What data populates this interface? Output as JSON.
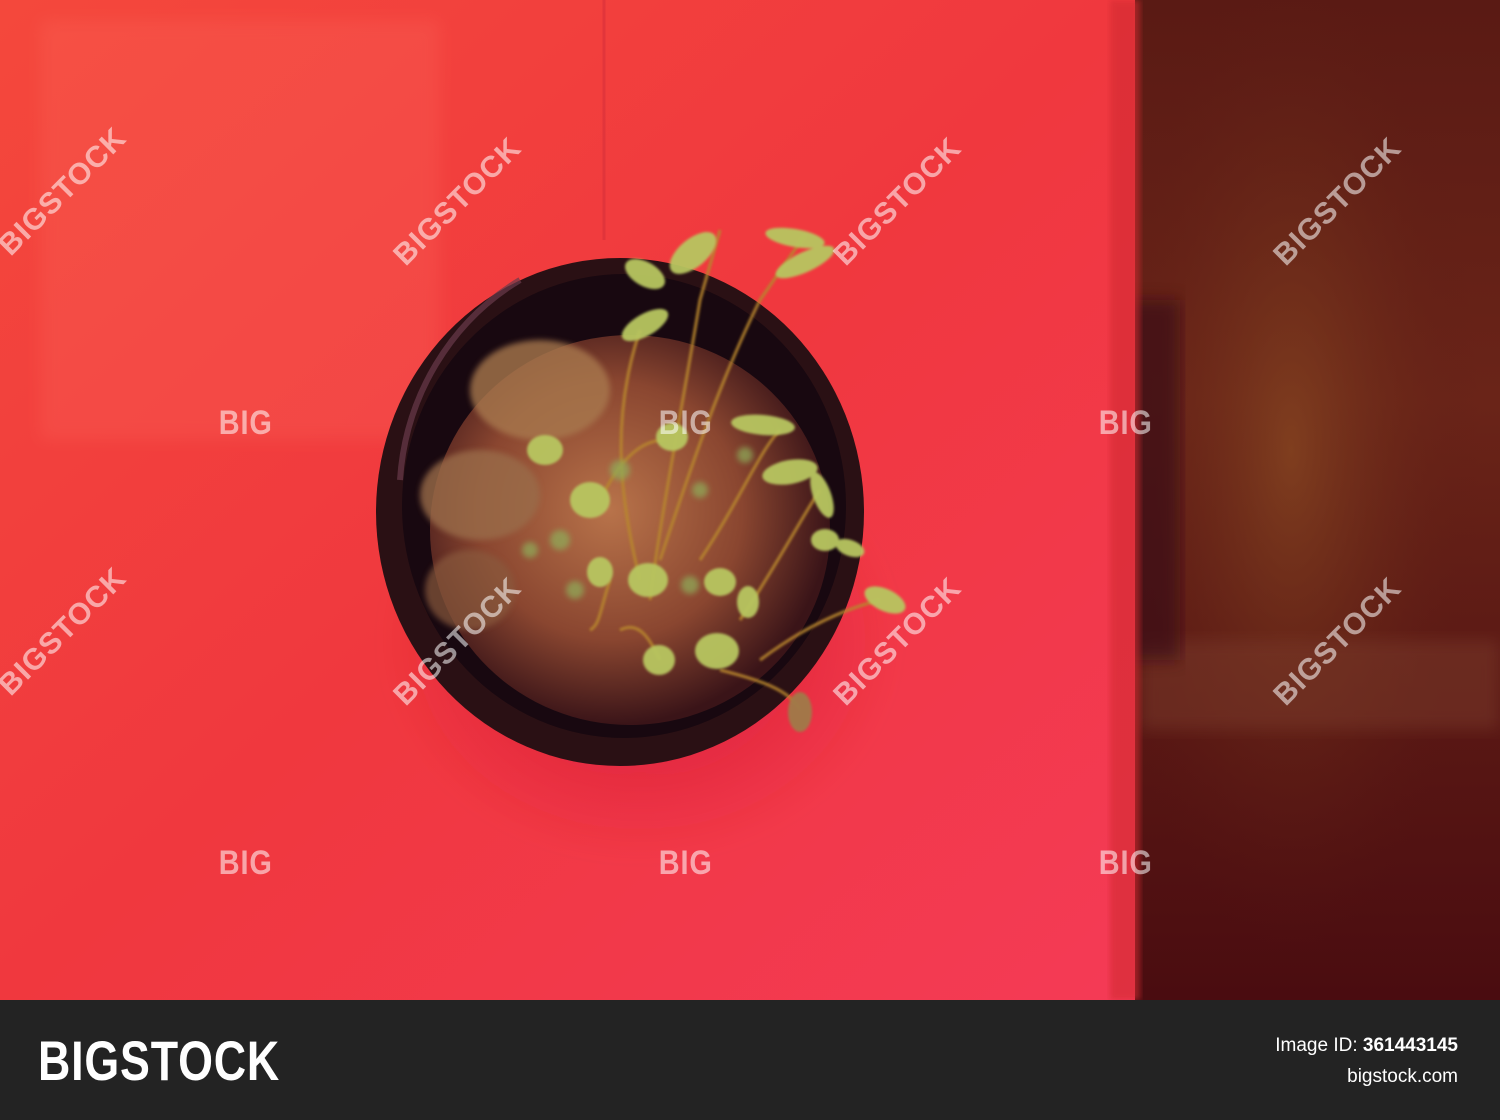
{
  "photo": {
    "subject": "seedling-in-black-pot",
    "colors": {
      "wall": "#f03a3a",
      "pot": "#241018",
      "leaf": "#b9c864",
      "background": "#5a1a12"
    }
  },
  "watermarks": {
    "diagonal": "BIGSTOCK",
    "short": "BIG"
  },
  "footer": {
    "logo": "BIGSTOCK",
    "image_id_label": "Image ID:",
    "image_id_value": "361443145",
    "site": "bigstock.com"
  }
}
